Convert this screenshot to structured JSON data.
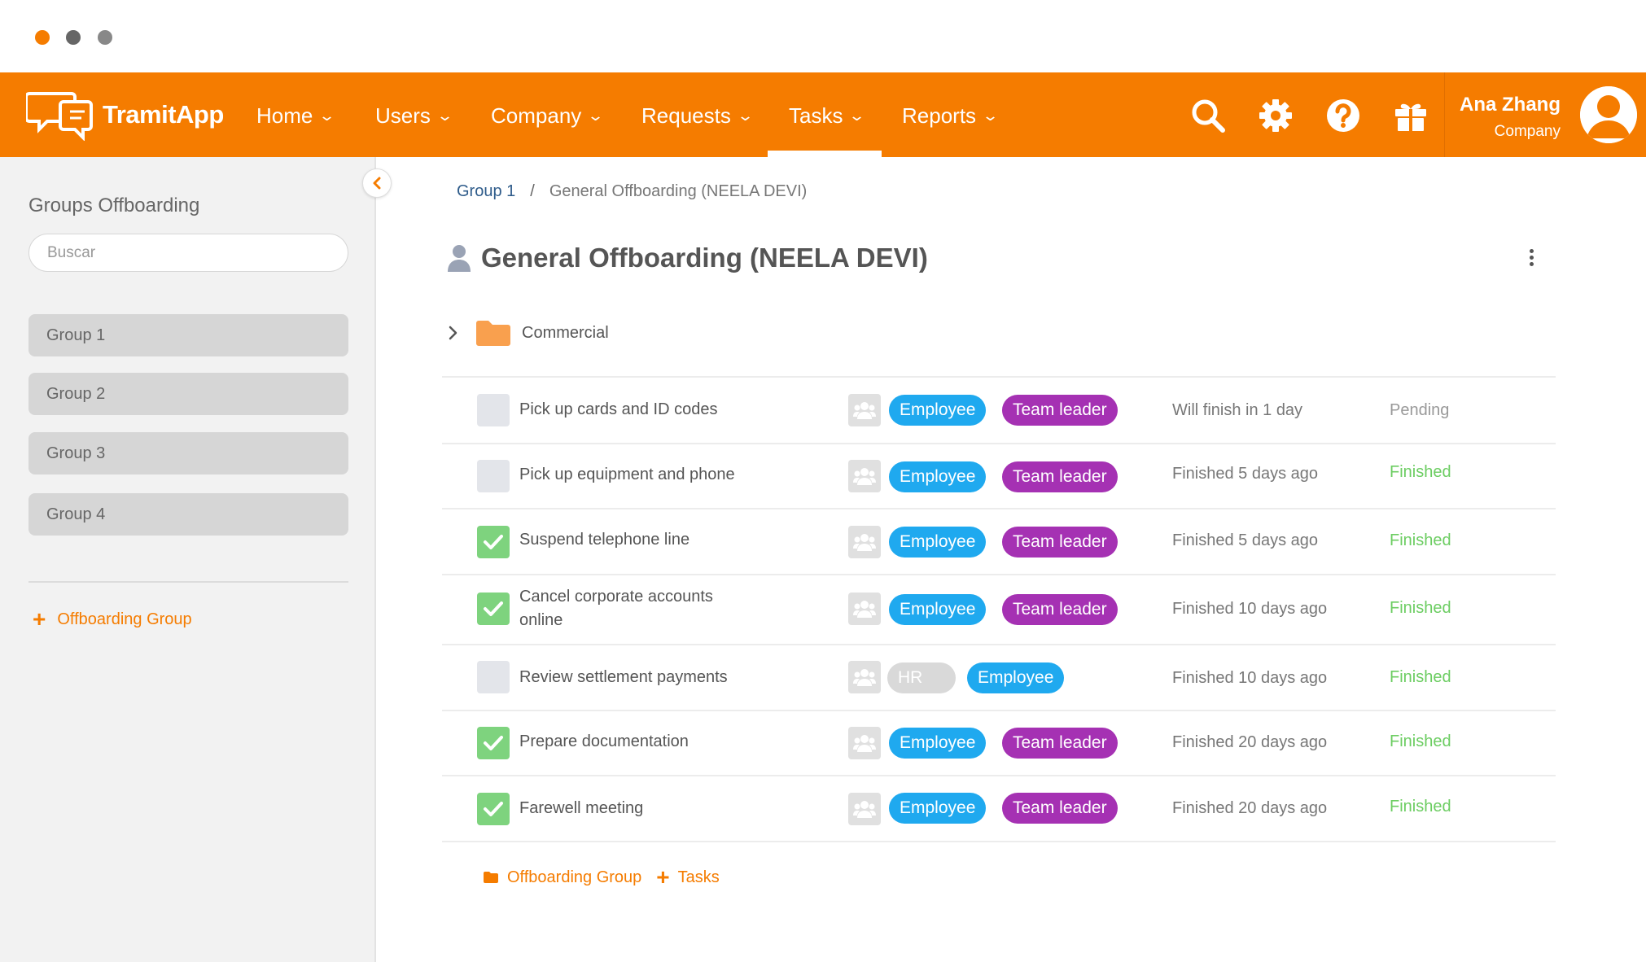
{
  "app": {
    "brand": "TramitApp",
    "accent": "#f57c00"
  },
  "nav": {
    "items": [
      {
        "label": "Home"
      },
      {
        "label": "Users"
      },
      {
        "label": "Company"
      },
      {
        "label": "Requests"
      },
      {
        "label": "Tasks",
        "active": true
      },
      {
        "label": "Reports"
      }
    ],
    "icons": [
      "search-icon",
      "gear-icon",
      "help-icon",
      "gift-icon"
    ]
  },
  "user": {
    "name": "Ana Zhang",
    "role": "Company"
  },
  "sidebar": {
    "title": "Groups Offboarding",
    "search_placeholder": "Buscar",
    "groups": [
      {
        "label": "Group 1"
      },
      {
        "label": "Group 2"
      },
      {
        "label": "Group 3"
      },
      {
        "label": "Group 4"
      }
    ],
    "add_label": "Offboarding Group"
  },
  "breadcrumb": {
    "parent": "Group 1",
    "separator": "/",
    "current": "General Offboarding  (NEELA DEVI)"
  },
  "page": {
    "title": "General Offboarding (NEELA DEVI)"
  },
  "folder": {
    "label": "Commercial"
  },
  "tasks": [
    {
      "name": "Pick up cards and ID codes",
      "checked": false,
      "roles": [
        "Employee",
        "Team leader"
      ],
      "due": "Will finish in 1 day",
      "status": "Pending"
    },
    {
      "name": "Pick up equipment and phone",
      "checked": false,
      "roles": [
        "Employee",
        "Team leader"
      ],
      "due": "Finished 5 days ago",
      "status": "Finished"
    },
    {
      "name": "Suspend telephone line",
      "checked": true,
      "roles": [
        "Employee",
        "Team leader"
      ],
      "due": "Finished 5 days ago",
      "status": "Finished"
    },
    {
      "name": "Cancel corporate accounts online",
      "checked": true,
      "roles": [
        "Employee",
        "Team leader"
      ],
      "due": "Finished 10 days ago",
      "status": "Finished"
    },
    {
      "name": "Review settlement payments",
      "checked": false,
      "roles": [
        "HR",
        "Employee"
      ],
      "due": "Finished 10 days ago",
      "status": "Finished"
    },
    {
      "name": "Prepare documentation",
      "checked": true,
      "roles": [
        "Employee",
        "Team leader"
      ],
      "due": "Finished 20 days ago",
      "status": "Finished"
    },
    {
      "name": "Farewell meeting",
      "checked": true,
      "roles": [
        "Employee",
        "Team leader"
      ],
      "due": "Finished 20 days ago",
      "status": "Finished"
    }
  ],
  "footer": {
    "group_label": "Offboarding Group",
    "tasks_label": "Tasks"
  },
  "colors": {
    "employee": "#1fa9ef",
    "team_leader": "#a531b3",
    "hr": "#d9d9d9",
    "finished": "#6ccd62",
    "pending": "#999999"
  }
}
